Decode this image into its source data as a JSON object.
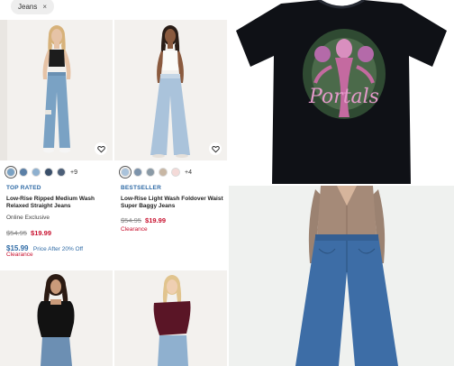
{
  "filter": {
    "chip_label": "Jeans",
    "chip_close": "×"
  },
  "products": [
    {
      "swatches": [
        "#7aa2c4",
        "#5b7fa6",
        "#8eb0cf",
        "#3a4f6a",
        "#4c5f78"
      ],
      "more_colors": "+9",
      "badge": "TOP RATED",
      "name": "Low-Rise Ripped Medium Wash Relaxed Straight Jeans",
      "tag": "Online Exclusive",
      "original_price": "$54.95",
      "sale_price": "$19.99",
      "after_discount_price": "$15.99",
      "after_discount_label": "Price After 20% Off",
      "status": "Clearance"
    },
    {
      "swatches": [
        "#aac3db",
        "#7c93ab",
        "#8a9aa6",
        "#c8b7a4",
        "#f4dad8"
      ],
      "more_colors": "+4",
      "badge": "BESTSELLER",
      "name": "Low-Rise Light Wash Foldover Waist Super Baggy Jeans",
      "original_price": "$54.95",
      "sale_price": "$19.99",
      "status": "Clearance"
    }
  ],
  "tee": {
    "graphic_text": "Portals"
  },
  "colors": {
    "accent_blue": "#2e6aa5",
    "sale_red": "#c8102e",
    "tee_black": "#0f1116"
  },
  "icons": {
    "favorite": "heart-icon",
    "remove_filter": "close-icon"
  }
}
